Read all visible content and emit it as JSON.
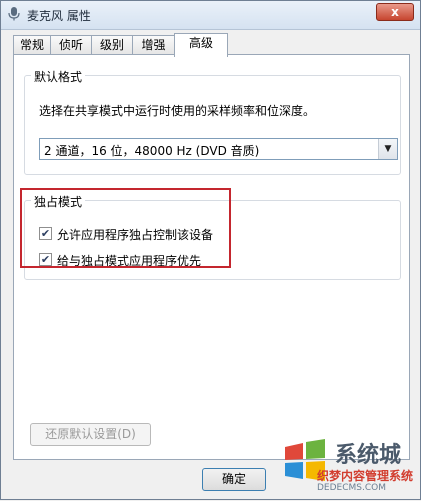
{
  "window": {
    "title": "麦克风 属性",
    "close_label": "x"
  },
  "tabs": [
    {
      "label": "常规"
    },
    {
      "label": "侦听"
    },
    {
      "label": "级别"
    },
    {
      "label": "增强"
    },
    {
      "label": "高级"
    }
  ],
  "default_format": {
    "group_label": "默认格式",
    "description": "选择在共享模式中运行时使用的采样频率和位深度。",
    "selected": "2 通道，16 位，48000 Hz (DVD 音质)"
  },
  "exclusive_mode": {
    "group_label": "独占模式",
    "options": [
      {
        "label": "允许应用程序独占控制该设备",
        "checked": true
      },
      {
        "label": "给与独占模式应用程序优先",
        "checked": true
      }
    ]
  },
  "buttons": {
    "restore_defaults": "还原默认设置(D)",
    "ok": "确定"
  },
  "watermark": {
    "line1": "系统城",
    "line2": "织梦内容管理系统",
    "line3": "DEDECMS.COM"
  },
  "colors": {
    "highlight": "#c4262e",
    "watermark_red": "#d23d2f"
  }
}
